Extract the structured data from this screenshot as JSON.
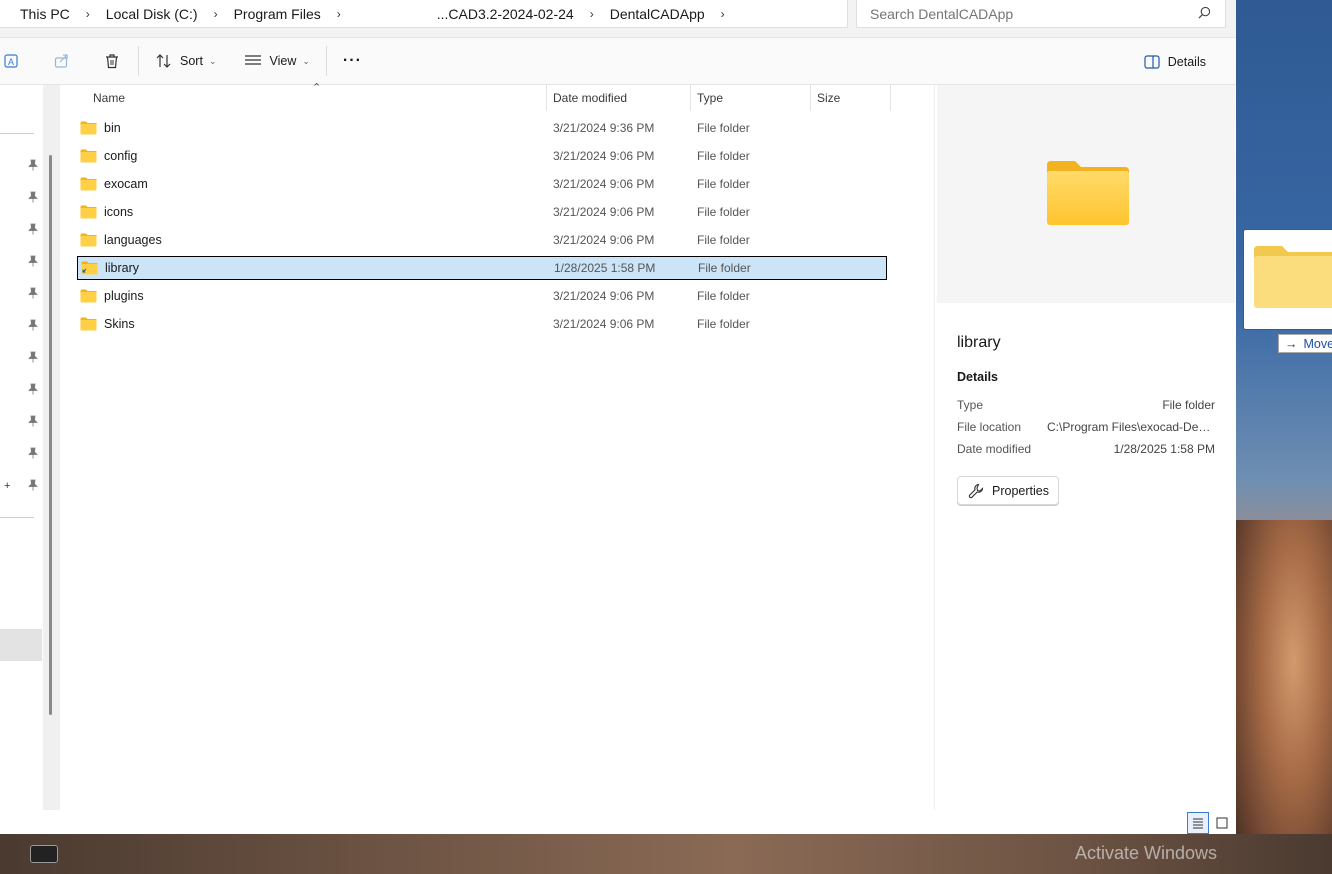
{
  "breadcrumb": {
    "items": [
      "This PC",
      "Local Disk (C:)",
      "Program Files",
      "...CAD3.2-2024-02-24",
      "DentalCADApp"
    ]
  },
  "search": {
    "placeholder": "Search DentalCADApp"
  },
  "toolbar": {
    "sort_label": "Sort",
    "view_label": "View",
    "more_label": "···",
    "details_label": "Details"
  },
  "columns": {
    "name": "Name",
    "date": "Date modified",
    "type": "Type",
    "size": "Size"
  },
  "files": [
    {
      "name": "bin",
      "date": "3/21/2024 9:36 PM",
      "type": "File folder"
    },
    {
      "name": "config",
      "date": "3/21/2024 9:06 PM",
      "type": "File folder"
    },
    {
      "name": "exocam",
      "date": "3/21/2024 9:06 PM",
      "type": "File folder"
    },
    {
      "name": "icons",
      "date": "3/21/2024 9:06 PM",
      "type": "File folder"
    },
    {
      "name": "languages",
      "date": "3/21/2024 9:06 PM",
      "type": "File folder"
    },
    {
      "name": "library",
      "date": "1/28/2025 1:58 PM",
      "type": "File folder",
      "selected": true
    },
    {
      "name": "plugins",
      "date": "3/21/2024 9:06 PM",
      "type": "File folder"
    },
    {
      "name": "Skins",
      "date": "3/21/2024 9:06 PM",
      "type": "File folder"
    }
  ],
  "details": {
    "title": "library",
    "section": "Details",
    "type_label": "Type",
    "type_value": "File folder",
    "location_label": "File location",
    "location_value": "C:\\Program Files\\exocad-Den...",
    "modified_label": "Date modified",
    "modified_value": "1/28/2025 1:58 PM",
    "properties_label": "Properties"
  },
  "drag": {
    "tip": "Move"
  },
  "desktop": {
    "watermark": "Activate Windows"
  },
  "nav": {
    "plus": "+"
  },
  "colors": {
    "selection_bg": "#cce4f7",
    "folder_yellow": "#ffca3a",
    "folder_tab": "#f2b320",
    "accent": "#3b7bd0"
  }
}
